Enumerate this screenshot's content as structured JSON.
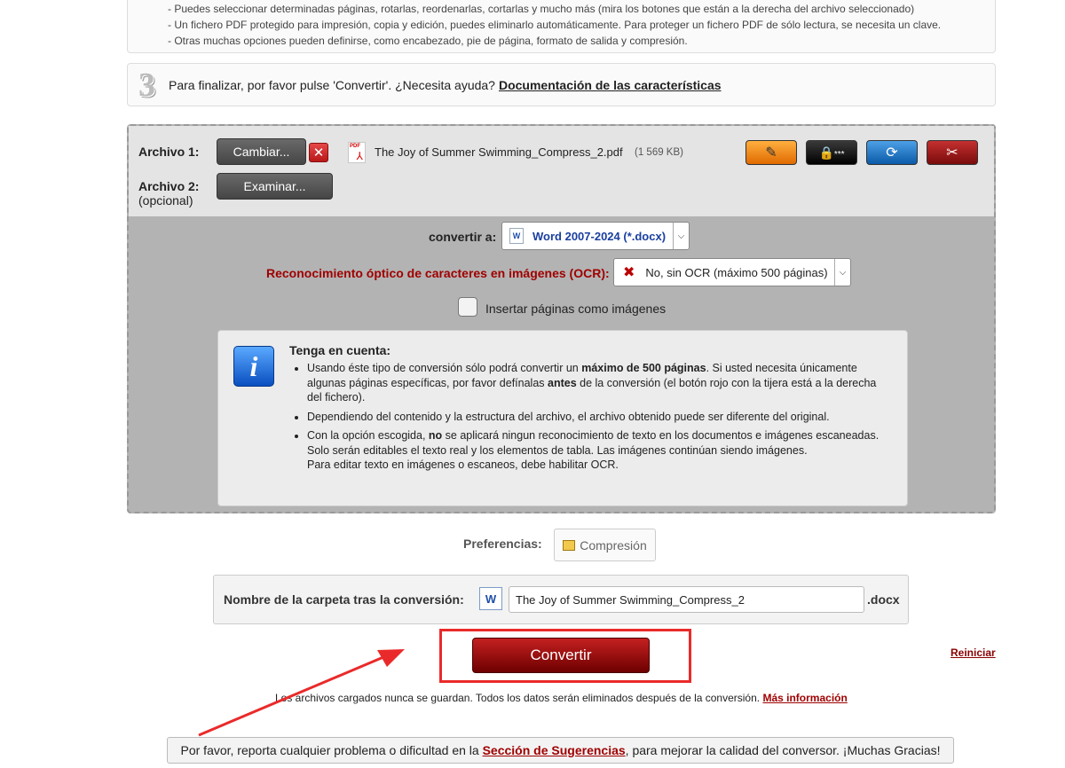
{
  "top_info": {
    "items": [
      "- Puedes seleccionar determinadas páginas, rotarlas, reordenarlas, cortarlas y mucho más (mira los botones que están a la derecha del archivo seleccionado)",
      "- Un fichero PDF protegido para impresión, copia y edición, puedes eliminarlo automáticamente. Para proteger un fichero PDF de sólo lectura, se necesita un clave.",
      "- Otras muchas opciones pueden definirse, como encabezado, pie de página, formato de salida y compresión."
    ]
  },
  "step3": {
    "number": "3",
    "text": "Para finalizar, por favor pulse 'Convertir'. ¿Necesita ayuda?",
    "link": "Documentación de las características"
  },
  "files": {
    "file1_label": "Archivo 1:",
    "change_button": "Cambiar...",
    "remove_icon": "x-icon",
    "file_name": "The Joy of Summer Swimming_Compress_2.pdf",
    "file_size": "(1 569 KB)",
    "file2_label": "Archivo 2:",
    "file2_sub": "(opcional)",
    "browse_button": "Examinar...",
    "tools": [
      "magic-wand-icon",
      "lock-password-icon",
      "rotate-icon",
      "scissors-icon"
    ]
  },
  "convert_to": {
    "label": "convertir a:",
    "value": "Word 2007-2024 (*.docx)"
  },
  "ocr": {
    "label": "Reconocimiento óptico de caracteres en imágenes (OCR):",
    "value": "No, sin OCR (máximo 500 páginas)"
  },
  "insert_pages": {
    "label": "Insertar páginas como imágenes",
    "checked": false
  },
  "note": {
    "title": "Tenga en cuenta:",
    "b1_a": "Usando éste tipo de conversión sólo podrá convertir un ",
    "b1_b": "máximo de 500 páginas",
    "b1_c": ". Si usted necesita únicamente algunas páginas específicas, por favor defínalas ",
    "b1_d": "antes",
    "b1_e": " de la conversión (el botón rojo con la tijera está a la derecha del fichero).",
    "b2": "Dependiendo del contenido y la estructura del archivo, el archivo obtenido puede ser diferente del original.",
    "b3_a": "Con la opción escogida, ",
    "b3_b": "no",
    "b3_c": " se aplicará ningun reconocimiento de texto en los documentos e imágenes escaneadas. Solo serán editables el texto real y los elementos de tabla. Las imágenes continúan siendo imágenes.",
    "b3_d": "Para editar texto en imágenes o escaneos, debe habilitar OCR."
  },
  "preferences": {
    "label": "Preferencias:",
    "compression": "Compresión"
  },
  "folder": {
    "label": "Nombre de la carpeta tras la conversión:",
    "value": "The Joy of Summer Swimming_Compress_2",
    "ext": ".docx"
  },
  "actions": {
    "convert": "Convertir",
    "reset": "Reiniciar"
  },
  "footnote": {
    "text": "Los archivos cargados nunca se guardan. Todos los datos serán eliminados después de la conversión.",
    "link": "Más información"
  },
  "feedback": {
    "before": "Por favor, reporta cualquier problema o dificultad en la ",
    "link": "Sección de Sugerencias",
    "after": ", para mejorar la calidad del conversor. ¡Muchas Gracias!"
  },
  "colors": {
    "accent_red": "#a00000",
    "annotation_red": "#ea2a2a"
  }
}
